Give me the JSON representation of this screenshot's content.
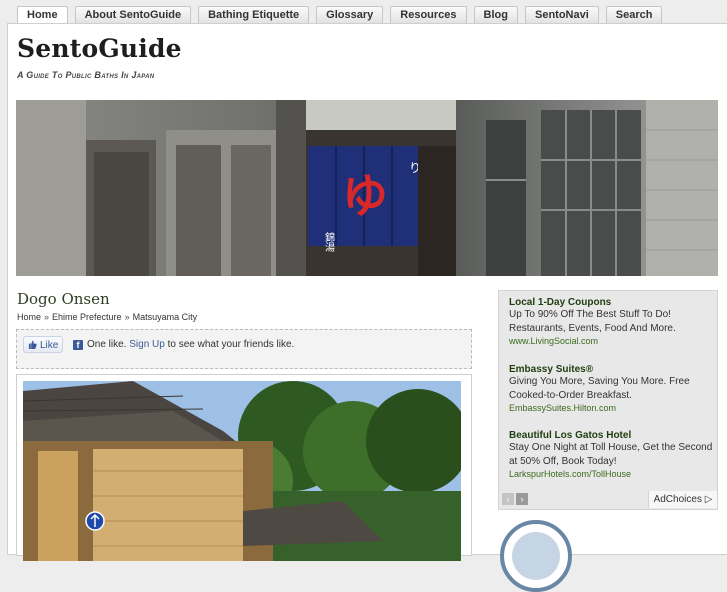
{
  "nav": {
    "tabs": [
      {
        "label": "Home",
        "active": true
      },
      {
        "label": "About SentoGuide"
      },
      {
        "label": "Bathing Etiquette"
      },
      {
        "label": "Glossary"
      },
      {
        "label": "Resources"
      },
      {
        "label": "Blog"
      },
      {
        "label": "SentoNavi"
      },
      {
        "label": "Search"
      }
    ]
  },
  "site": {
    "title": "SentoGuide",
    "tagline": "A Guide To Public Baths In Japan"
  },
  "post": {
    "title": "Dogo Onsen",
    "breadcrumb": [
      "Home",
      "Ehime Prefecture",
      "Matsuyama City"
    ],
    "breadcrumb_sep": "»"
  },
  "facebook": {
    "like_label": "Like",
    "count_text": "One like.",
    "signup_label": "Sign Up",
    "suffix_text": "to see what your friends like."
  },
  "ads": [
    {
      "headline": "Local 1-Day Coupons",
      "body": "Up To 90% Off The Best Stuff To Do! Restaurants, Events, Food And More.",
      "url": "www.LivingSocial.com"
    },
    {
      "headline": "Embassy Suites®",
      "body": "Giving You More, Saving You More. Free Cooked-to-Order Breakfast.",
      "url": "EmbassySuites.Hilton.com"
    },
    {
      "headline": "Beautiful Los Gatos Hotel",
      "body": "Stay One Night at Toll House, Get the Second at 50% Off, Book Today!",
      "url": "LarkspurHotels.com/TollHouse"
    }
  ],
  "adchoices_label": "AdChoices",
  "icons": {
    "prev": "‹",
    "next": "›",
    "facebook": "f",
    "adchoices": "▷"
  },
  "colors": {
    "accent_green": "#2f3f22",
    "facebook_blue": "#3b5998",
    "page_bg": "#ededed"
  }
}
